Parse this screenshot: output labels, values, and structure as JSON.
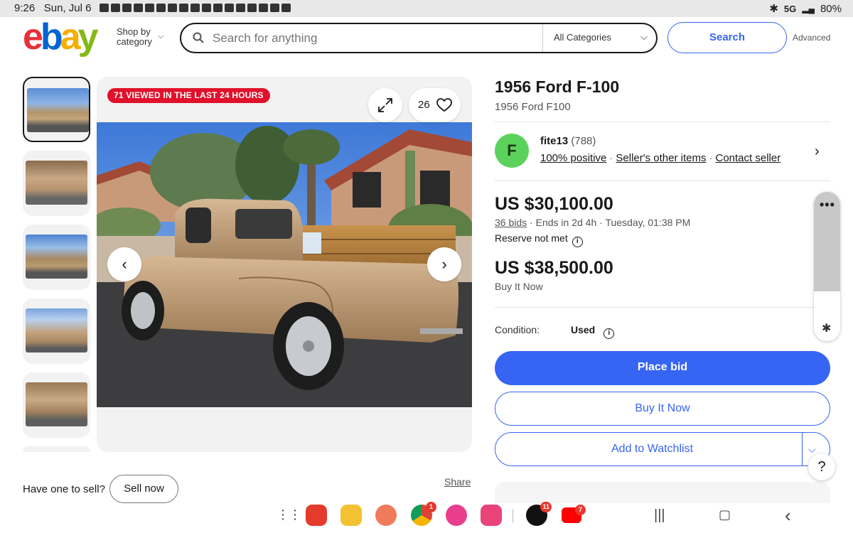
{
  "status": {
    "time": "9:26",
    "date": "Sun, Jul 6",
    "network": "5G",
    "battery": "80%"
  },
  "header": {
    "logo": {
      "e": "e",
      "b": "b",
      "a": "a",
      "y": "y"
    },
    "shop_by_line1": "Shop by",
    "shop_by_line2": "category",
    "search_placeholder": "Search for anything",
    "category": "All Categories",
    "search_button": "Search",
    "advanced": "Advanced"
  },
  "gallery": {
    "viewed_badge": "71 VIEWED IN THE LAST 24 HOURS",
    "watchers": "26"
  },
  "footer_left": {
    "have_one": "Have one to sell?",
    "sell_now": "Sell now",
    "share": "Share"
  },
  "listing": {
    "title": "1956 Ford F-100",
    "subtitle": "1956 Ford F100",
    "seller": {
      "initial": "F",
      "name": "fite13",
      "feedback": "(788)",
      "positive": "100% positive",
      "other_items": "Seller's other items",
      "contact": "Contact seller"
    },
    "price": "US $30,100.00",
    "bids": "36 bids",
    "ends": "Ends in 2d 4h",
    "end_time": "Tuesday, 01:38 PM",
    "reserve": "Reserve not met",
    "bin_price": "US $38,500.00",
    "bin_label": "Buy It Now",
    "condition_label": "Condition:",
    "condition_value": "Used",
    "place_bid": "Place bid",
    "buy_it_now": "Buy It Now",
    "add_to_watchlist": "Add to Watchlist"
  },
  "nav_badges": {
    "chrome": "1",
    "tiktok": "11",
    "youtube": "7"
  },
  "colors": {
    "accent": "#3665f3",
    "badge_red": "#e0112b",
    "avatar_green": "#5bd25b"
  }
}
